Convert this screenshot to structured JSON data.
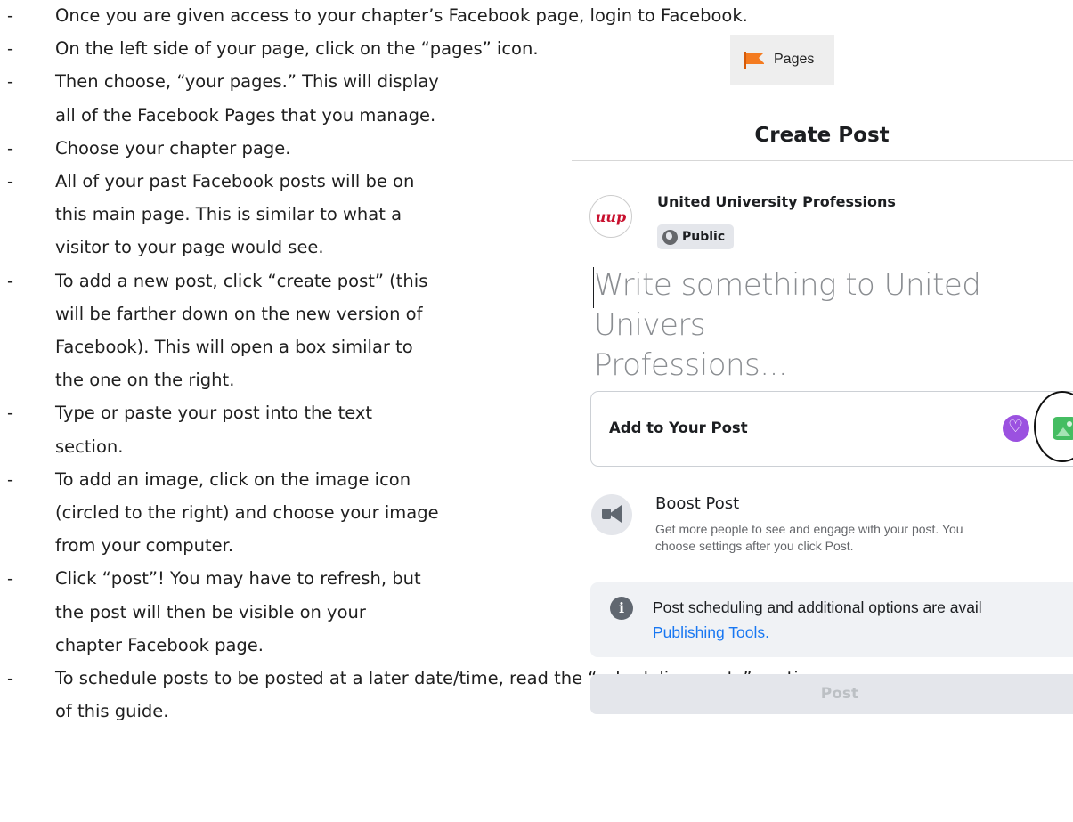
{
  "instructions": {
    "dash": "-",
    "steps": [
      {
        "lines": [
          "Once you are given access to your chapter’s Facebook page, login to Facebook."
        ]
      },
      {
        "lines": [
          "On the left side of your page, click on the “pages” icon."
        ]
      },
      {
        "lines": [
          "Then choose, “your pages.” This will display",
          "all of the Facebook Pages that you manage."
        ]
      },
      {
        "lines": [
          "Choose your chapter page."
        ]
      },
      {
        "lines": [
          "All of your past Facebook posts will be on",
          "this main page. This is similar to what a",
          "visitor to your page would see."
        ]
      },
      {
        "lines": [
          "To add a new post, click “create post” (this",
          "will be farther down on the new version of",
          "Facebook). This will open a box similar to",
          "the one on the right."
        ]
      },
      {
        "lines": [
          "Type or paste your post into the text",
          "section."
        ]
      },
      {
        "lines": [
          "To add an image, click on the image icon",
          "(circled to the right) and choose your image",
          "from your computer."
        ]
      },
      {
        "lines": [
          "Click “post”! You may have to refresh, but",
          "the post will then be visible on your",
          "chapter Facebook page."
        ]
      },
      {
        "lines": [
          "To schedule posts to be posted at a later date/time, read the “scheduling posts” section",
          "of this guide."
        ]
      }
    ]
  },
  "pages_chip": {
    "icon": "flag-icon",
    "label": "Pages",
    "flag_color": "#f47b20"
  },
  "create_post": {
    "title": "Create Post",
    "page_name": "United University Professions",
    "avatar_text": "uup",
    "audience": "Public",
    "placeholder_line1": "Write something to United Univers",
    "placeholder_line2": "Professions...",
    "add_to_post_label": "Add to Your Post",
    "add_icons": [
      "feeling-icon",
      "photo-icon"
    ],
    "boost_title": "Boost Post",
    "boost_desc_line1": "Get more people to see and engage with your post. You",
    "boost_desc_line2": "choose settings after you click Post.",
    "info_text": "Post scheduling and additional options are avail",
    "info_link": "Publishing Tools.",
    "post_button": "Post",
    "link_color": "#1877f2"
  }
}
